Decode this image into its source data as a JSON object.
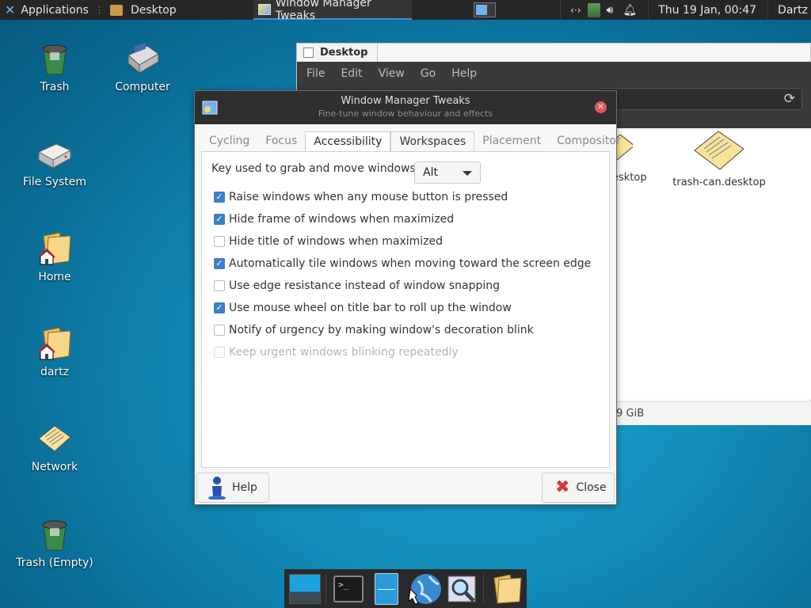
{
  "top_panel": {
    "applications_label": "Applications",
    "desktop_label": "Desktop",
    "task_label": "Window Manager Tweaks",
    "clock": "Thu 19 Jan, 00:47",
    "user": "Dartz"
  },
  "desktop_icons": [
    {
      "label": "Trash"
    },
    {
      "label": "Computer"
    },
    {
      "label": "File System"
    },
    {
      "label": "Home"
    },
    {
      "label": "dartz"
    },
    {
      "label": "Network"
    },
    {
      "label": "Trash (Empty)"
    }
  ],
  "file_manager": {
    "tab_title": "Desktop",
    "menu": [
      "File",
      "Edit",
      "View",
      "Go",
      "Help"
    ],
    "files": [
      {
        "label": "esktop"
      },
      {
        "label": "trash-can.desktop"
      }
    ],
    "status": ".9 GiB"
  },
  "dialog": {
    "title": "Window Manager Tweaks",
    "subtitle": "Fine-tune window behaviour and effects",
    "tabs": [
      "Cycling",
      "Focus",
      "Accessibility",
      "Workspaces",
      "Placement",
      "Compositor"
    ],
    "active_tab": "Accessibility",
    "key_label": "Key used to grab and move windows:",
    "key_value": "Alt",
    "options": [
      {
        "label": "Raise windows when any mouse button is pressed",
        "checked": true,
        "enabled": true
      },
      {
        "label": "Hide frame of windows when maximized",
        "checked": true,
        "enabled": true
      },
      {
        "label": "Hide title of windows when maximized",
        "checked": false,
        "enabled": true
      },
      {
        "label": "Automatically tile windows when moving toward the screen edge",
        "checked": true,
        "enabled": true
      },
      {
        "label": "Use edge resistance instead of window snapping",
        "checked": false,
        "enabled": true
      },
      {
        "label": "Use mouse wheel on title bar to roll up the window",
        "checked": true,
        "enabled": true
      },
      {
        "label": "Notify of urgency by making window's decoration blink",
        "checked": false,
        "enabled": true
      },
      {
        "label": "Keep urgent windows blinking repeatedly",
        "checked": false,
        "enabled": false
      }
    ],
    "help_label": "Help",
    "close_label": "Close"
  },
  "dock": {
    "items": [
      "show-desktop-icon",
      "terminal-icon",
      "file-manager-icon",
      "web-browser-icon",
      "search-icon",
      "folder-icon"
    ]
  },
  "colors": {
    "accent": "#3d7fc6",
    "panel_bg": "#262626",
    "desktop_bg": "#138fbc"
  }
}
